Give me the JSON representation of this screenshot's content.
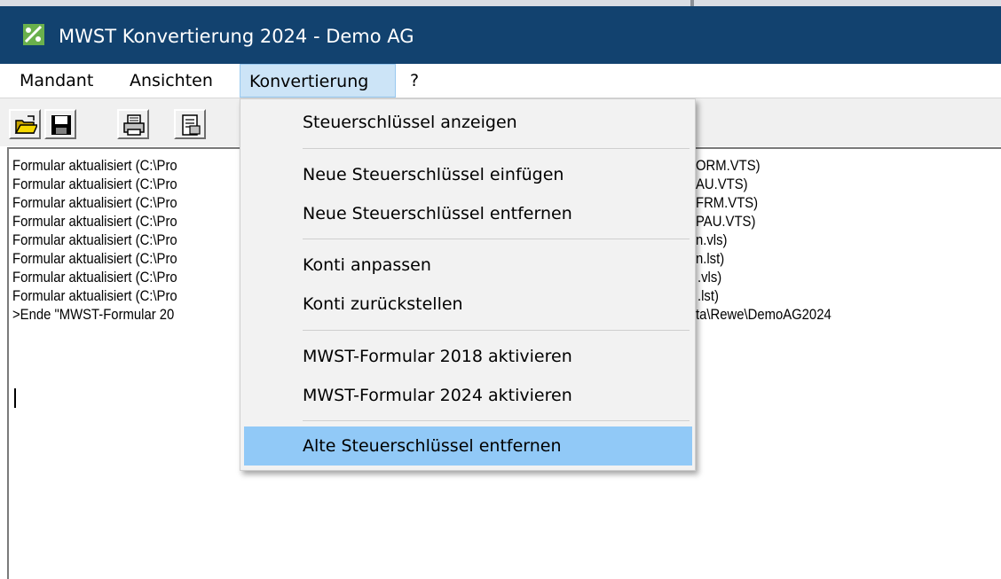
{
  "window": {
    "title": "MWST Konvertierung 2024 - Demo AG",
    "titlebar_color": "#12426f"
  },
  "menubar": {
    "items": [
      {
        "label": "Mandant"
      },
      {
        "label": "Ansichten"
      },
      {
        "label": "Konvertierung",
        "active": true
      },
      {
        "label": "?"
      }
    ]
  },
  "toolbar": {
    "buttons": [
      {
        "icon": "open-folder-icon"
      },
      {
        "icon": "save-disk-icon"
      },
      {
        "icon": "printer-icon"
      },
      {
        "icon": "properties-icon"
      }
    ]
  },
  "log": {
    "lines_left": [
      "Formular aktualisiert (C:\\Pro",
      "Formular aktualisiert (C:\\Pro",
      "Formular aktualisiert (C:\\Pro",
      "Formular aktualisiert (C:\\Pro",
      "Formular aktualisiert (C:\\Pro",
      "Formular aktualisiert (C:\\Pro",
      "Formular aktualisiert (C:\\Pro",
      "Formular aktualisiert (C:\\Pro",
      ">Ende \"MWST-Formular 20"
    ],
    "lines_right": [
      "ORM.VTS)",
      "AU.VTS)",
      "FRM.VTS)",
      "PAU.VTS)",
      "n.vls)",
      "n.lst)",
      ".vls)",
      ".lst)",
      "ta\\Rewe\\DemoAG2024"
    ]
  },
  "dropdown": {
    "items": [
      "Steuerschlüssel anzeigen",
      "Neue Steuerschlüssel einfügen",
      "Neue Steuerschlüssel entfernen",
      "Konti anpassen",
      "Konti zurückstellen",
      "MWST-Formular 2018 aktivieren",
      "MWST-Formular 2024 aktivieren",
      "Alte Steuerschlüssel entfernen"
    ],
    "highlighted": "Alte Steuerschlüssel entfernen",
    "highlight_color": "#91c9f7"
  }
}
